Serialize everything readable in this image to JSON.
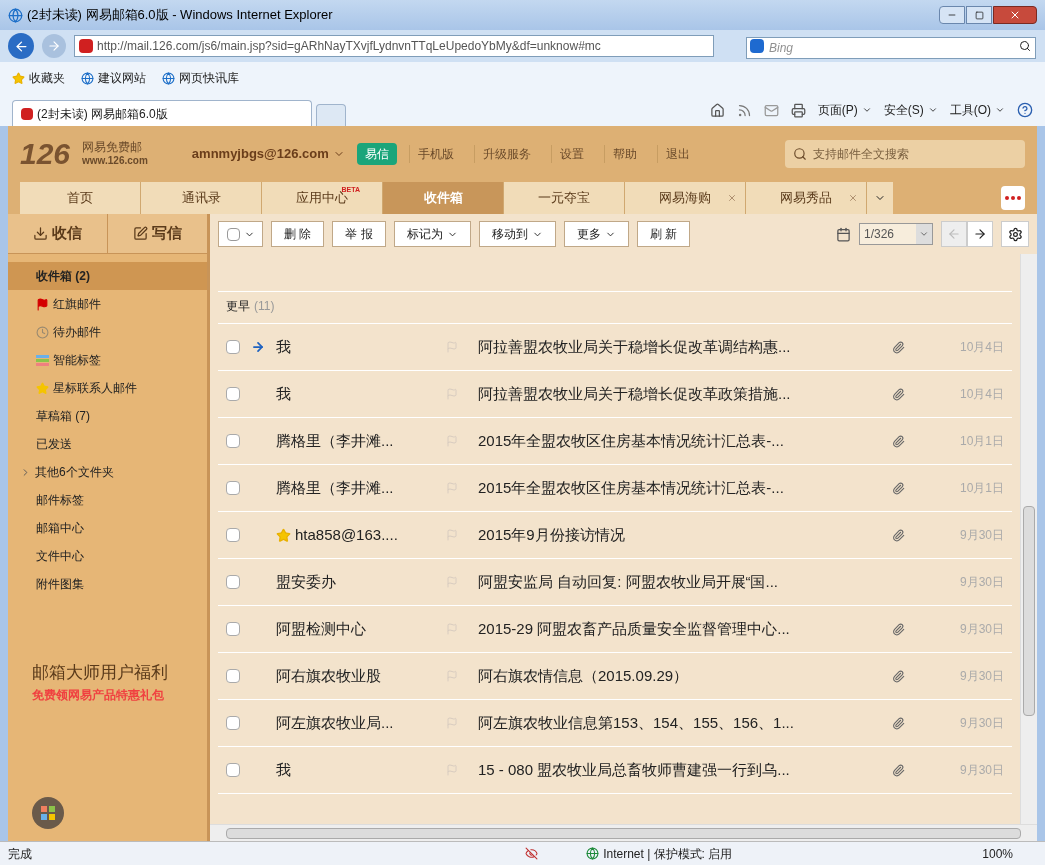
{
  "browser": {
    "title": "(2封未读) 网易邮箱6.0版 - Windows Internet Explorer",
    "address": "http://mail.126.com/js6/main.jsp?sid=gARhNayTXvjfLydnvnTTqLeUpedoYbMy&df=unknow#mc",
    "search_placeholder": "Bing",
    "favorites": [
      "收藏夹",
      "建议网站",
      "网页快讯库"
    ],
    "tab": "(2封未读) 网易邮箱6.0版",
    "commands": [
      "页面(P)",
      "安全(S)",
      "工具(O)"
    ]
  },
  "header": {
    "logo": "126",
    "logo_name": "网易免费邮",
    "logo_url": "www.126.com",
    "account": "amnmyjbgs@126.com",
    "yixin": "易信",
    "links": [
      "手机版",
      "升级服务",
      "设置",
      "帮助",
      "退出"
    ],
    "search_placeholder": "支持邮件全文搜索"
  },
  "nav_tabs": [
    {
      "label": "首页",
      "selected": false,
      "closable": false
    },
    {
      "label": "通讯录",
      "selected": false,
      "closable": false
    },
    {
      "label": "应用中心",
      "badge": "BETA",
      "selected": false,
      "closable": false
    },
    {
      "label": "收件箱",
      "selected": true,
      "closable": false
    },
    {
      "label": "一元夺宝",
      "selected": false,
      "closable": false
    },
    {
      "label": "网易海购",
      "selected": false,
      "closable": true
    },
    {
      "label": "网易秀品",
      "selected": false,
      "closable": true
    }
  ],
  "sidebar": {
    "receive": "收信",
    "compose": "写信",
    "items": [
      {
        "label": "收件箱 (2)",
        "kind": "plain",
        "selected": true
      },
      {
        "label": "红旗邮件",
        "kind": "flag",
        "selected": false
      },
      {
        "label": "待办邮件",
        "kind": "clock",
        "selected": false
      },
      {
        "label": "智能标签",
        "kind": "tags",
        "selected": false
      },
      {
        "label": "星标联系人邮件",
        "kind": "star",
        "selected": false
      },
      {
        "label": "草稿箱 (7)",
        "kind": "plain",
        "selected": false
      },
      {
        "label": "已发送",
        "kind": "plain",
        "selected": false
      },
      {
        "label": "其他6个文件夹",
        "kind": "group",
        "selected": false
      },
      {
        "label": "邮件标签",
        "kind": "plain",
        "selected": false
      },
      {
        "label": "邮箱中心",
        "kind": "plain",
        "selected": false
      },
      {
        "label": "文件中心",
        "kind": "plain",
        "selected": false
      },
      {
        "label": "附件图集",
        "kind": "plain",
        "selected": false
      }
    ],
    "promo_title": "邮箱大师用户福利",
    "promo_subtitle": "免费领网易产品特惠礼包"
  },
  "toolbar": {
    "select_all_checked": false,
    "buttons": [
      {
        "label": "删 除",
        "dropdown": false
      },
      {
        "label": "举 报",
        "dropdown": false
      },
      {
        "label": "标记为",
        "dropdown": true
      },
      {
        "label": "移动到",
        "dropdown": true
      },
      {
        "label": "更多",
        "dropdown": true
      },
      {
        "label": "刷 新",
        "dropdown": false
      }
    ],
    "page": "1/326"
  },
  "mail_list": {
    "group": "更早",
    "group_count": "(11)",
    "rows": [
      {
        "checked": false,
        "replied": true,
        "starred": false,
        "sender": "我",
        "flagged": false,
        "subject": "阿拉善盟农牧业局关于稳增长促改革调结构惠...",
        "attachment": true,
        "date": "10月4日"
      },
      {
        "checked": false,
        "replied": false,
        "starred": false,
        "sender": "我",
        "flagged": false,
        "subject": "阿拉善盟农牧业局关于稳增长促改革政策措施...",
        "attachment": true,
        "date": "10月4日"
      },
      {
        "checked": false,
        "replied": false,
        "starred": false,
        "sender": "腾格里（李井滩...",
        "flagged": false,
        "subject": "2015年全盟农牧区住房基本情况统计汇总表-...",
        "attachment": true,
        "date": "10月1日"
      },
      {
        "checked": false,
        "replied": false,
        "starred": false,
        "sender": "腾格里（李井滩...",
        "flagged": false,
        "subject": "2015年全盟农牧区住房基本情况统计汇总表-...",
        "attachment": true,
        "date": "10月1日"
      },
      {
        "checked": false,
        "replied": false,
        "starred": true,
        "sender": "hta858@163....",
        "flagged": false,
        "subject": "2015年9月份接访情况",
        "attachment": true,
        "date": "9月30日"
      },
      {
        "checked": false,
        "replied": false,
        "starred": false,
        "sender": "盟安委办",
        "flagged": false,
        "subject": "阿盟安监局 自动回复: 阿盟农牧业局开展“国...",
        "attachment": false,
        "date": "9月30日"
      },
      {
        "checked": false,
        "replied": false,
        "starred": false,
        "sender": "阿盟检测中心",
        "flagged": false,
        "subject": "2015-29 阿盟农畜产品质量安全监督管理中心...",
        "attachment": true,
        "date": "9月30日"
      },
      {
        "checked": false,
        "replied": false,
        "starred": false,
        "sender": "阿右旗农牧业股",
        "flagged": false,
        "subject": "阿右旗农情信息（2015.09.29）",
        "attachment": true,
        "date": "9月30日"
      },
      {
        "checked": false,
        "replied": false,
        "starred": false,
        "sender": "阿左旗农牧业局...",
        "flagged": false,
        "subject": "阿左旗农牧业信息第153、154、155、156、1...",
        "attachment": true,
        "date": "9月30日"
      },
      {
        "checked": false,
        "replied": false,
        "starred": false,
        "sender": "我",
        "flagged": false,
        "subject": "15 - 080 盟农牧业局总畜牧师曹建强一行到乌...",
        "attachment": true,
        "date": "9月30日"
      }
    ]
  },
  "status_bar": {
    "text": "完成",
    "zone": "Internet | 保护模式: 启用",
    "zoom": "100%"
  }
}
